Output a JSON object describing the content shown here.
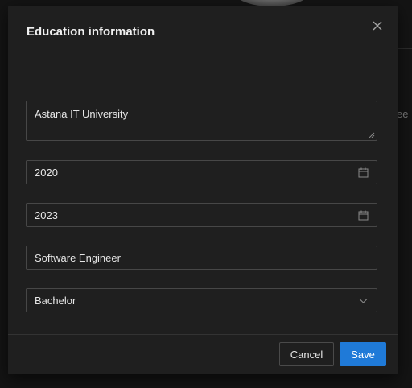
{
  "background": {
    "partial_text": "ee"
  },
  "modal": {
    "title": "Education information",
    "fields": {
      "institution": {
        "value": "Astana IT University"
      },
      "start_year": {
        "value": "2020"
      },
      "end_year": {
        "value": "2023"
      },
      "specialty": {
        "value": "Software Engineer"
      },
      "degree": {
        "value": "Bachelor"
      }
    },
    "buttons": {
      "cancel_label": "Cancel",
      "save_label": "Save"
    }
  },
  "icons": {
    "close": "close-icon",
    "calendar": "calendar-icon",
    "chevron": "chevron-down-icon",
    "resize": "resize-handle-icon"
  },
  "colors": {
    "modal_bg": "#1f1f1f",
    "border": "#474747",
    "primary": "#1f7ad8",
    "text": "#e6e6e6"
  }
}
